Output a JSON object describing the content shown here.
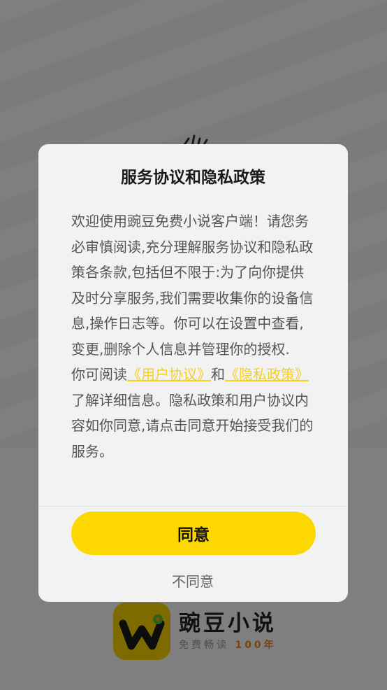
{
  "splash": {
    "brand_name": "豌豆小说",
    "slogan_prefix": "免费畅读",
    "slogan_accent": "100年",
    "brand_color": "#fdd700",
    "accent_color": "#f08a1c"
  },
  "dialog": {
    "title": "服务协议和隐私政策",
    "paragraph1": "欢迎使用豌豆免费小说客户端！请您务必审慎阅读,充分理解服务协议和隐私政策各条款,包括但不限于:为了向你提供及时分享服务,我们需要收集你的设备信息,操作日志等。你可以在设置中查看,变更,删除个人信息并管理你的授权.",
    "p2_prefix": "你可阅读",
    "link_user_agreement": "《用户协议》",
    "p2_and": "和",
    "link_privacy_policy": "《隐私政策》",
    "p2_suffix": "了解详细信息。隐私政策和用户协议内容如你同意,请点击同意开始接受我们的服务。",
    "agree_label": "同意",
    "disagree_label": "不同意",
    "link_color": "#f6cf23",
    "button_color": "#fdd700"
  }
}
